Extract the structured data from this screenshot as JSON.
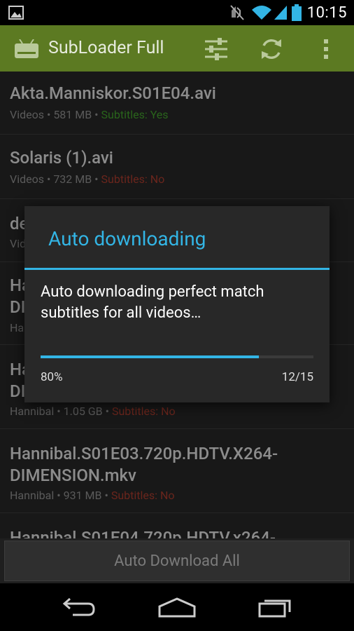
{
  "status_bar": {
    "time": "10:15",
    "icons": [
      "image-notification-icon",
      "mute-icon",
      "wifi-icon",
      "signal-icon",
      "battery-icon"
    ]
  },
  "action_bar": {
    "title": "SubLoader Full",
    "actions": [
      "filter-settings-icon",
      "refresh-icon",
      "overflow-menu-icon"
    ],
    "color": "#5c7a22"
  },
  "list": {
    "items": [
      {
        "title": "Akta.Manniskor.S01E04.avi",
        "folder": "Videos",
        "size": "581 MB",
        "subtitles": "Subtitles: Yes"
      },
      {
        "title": "Solaris (1).avi",
        "folder": "Videos",
        "size": "732 MB",
        "subtitles": "Subtitles: No"
      },
      {
        "title": "de",
        "folder": "Vid",
        "size": "",
        "subtitles": ""
      },
      {
        "title": "Ha",
        "title2": "DI",
        "folder": "Ha",
        "size": "",
        "subtitles": ""
      },
      {
        "title": "Ha",
        "title2": "DI",
        "folder": "Hannibal",
        "size": "1.05 GB",
        "subtitles": "Subtitles: No"
      },
      {
        "title": "Hannibal.S01E03.720p.HDTV.X264-",
        "title2": "DIMENSION.mkv",
        "folder": "Hannibal",
        "size": "931 MB",
        "subtitles": "Subtitles: No"
      },
      {
        "title": "Hannibal.S01E04.720p.HDTV.x264-",
        "folder": "",
        "size": "",
        "subtitles": ""
      }
    ],
    "separator": " • "
  },
  "dialog": {
    "title": "Auto downloading",
    "message": "Auto downloading perfect match subtitles for all videos…",
    "progress_percent": "80%",
    "progress_value": 0.8,
    "progress_count": "12/15",
    "accent": "#33b5e5"
  },
  "bottom": {
    "button_label": "Auto Download All"
  },
  "nav_bar": {
    "buttons": [
      "back-icon",
      "home-icon",
      "recent-apps-icon"
    ]
  }
}
